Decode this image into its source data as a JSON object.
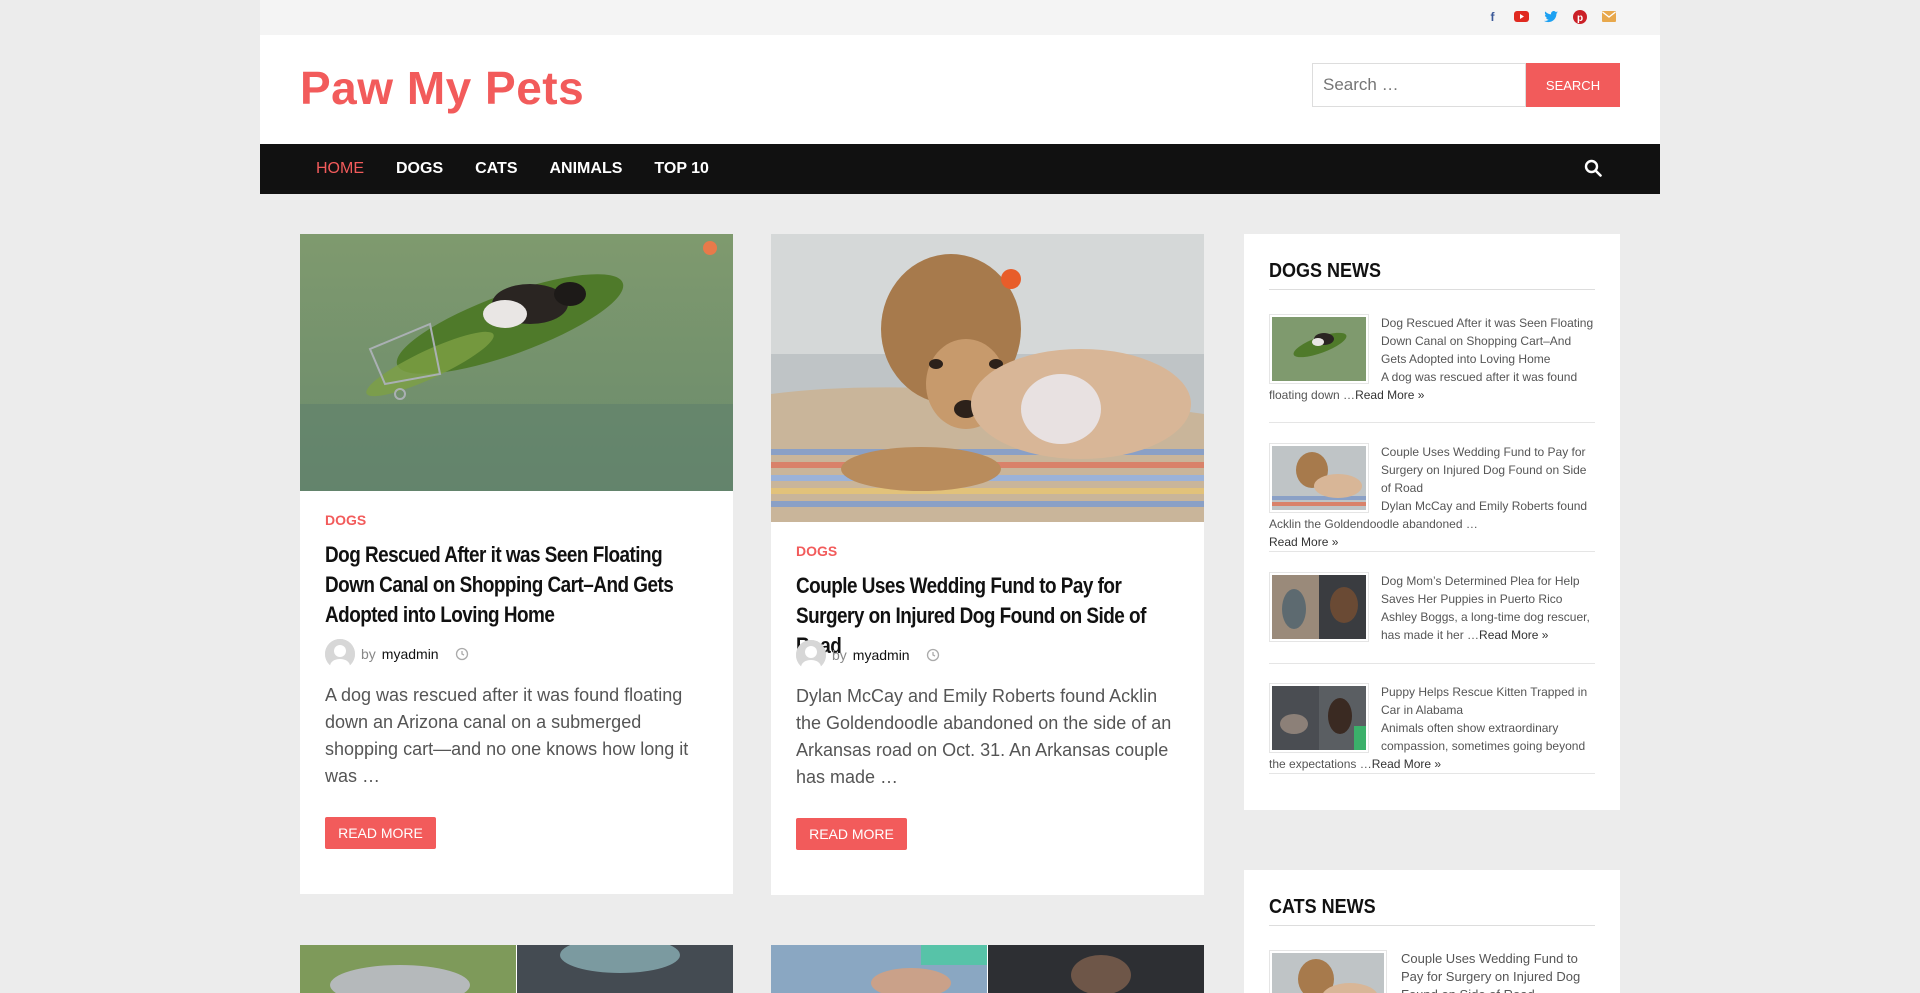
{
  "site": {
    "logo": "Paw My Pets",
    "search_placeholder": "Search …",
    "search_button": "Search"
  },
  "social_icons": [
    "facebook-icon",
    "youtube-icon",
    "twitter-icon",
    "pinterest-icon",
    "email-icon"
  ],
  "nav": {
    "items": [
      "HOME",
      "DOGS",
      "CATS",
      "ANIMALS",
      "TOP 10"
    ],
    "active": "HOME"
  },
  "posts": [
    {
      "category": "DOGS",
      "title": "Dog Rescued After it was Seen Floating Down Canal on Shopping Cart–And Gets Adopted into Loving Home",
      "by": "by",
      "author": "myadmin",
      "excerpt": "A dog was rescued after it was found floating down an Arizona canal on a submerged shopping cart—and no one knows how long it was …",
      "read_more": "Read More"
    },
    {
      "category": "DOGS",
      "title": "Couple Uses Wedding Fund to Pay for Surgery on Injured Dog Found on Side of Road",
      "by": "by",
      "author": "myadmin",
      "excerpt": "Dylan McCay and Emily Roberts found Acklin the Goldendoodle abandoned on the side of an Arkansas road on Oct. 31. An Arkansas couple has made …",
      "read_more": "Read More"
    }
  ],
  "dogs_news": {
    "title": "DOGS NEWS",
    "items": [
      {
        "title": "Dog Rescued After it was Seen Floating Down Canal on Shopping Cart–And Gets Adopted into Loving Home",
        "excerpt": "A dog was rescued after it was found floating down …",
        "read_more": "Read More »"
      },
      {
        "title": "Couple Uses Wedding Fund to Pay for Surgery on Injured Dog Found on Side of Road",
        "excerpt": "Dylan McCay and Emily Roberts found Acklin the Goldendoodle abandoned …",
        "read_more": "Read More »"
      },
      {
        "title": "Dog Mom’s Determined Plea for Help Saves Her Puppies in Puerto Rico",
        "excerpt": "Ashley Boggs, a long-time dog rescuer, has made it her …",
        "read_more": "Read More »"
      },
      {
        "title": "Puppy Helps Rescue Kitten Trapped in Car in Alabama",
        "excerpt": "Animals often show extraordinary compassion, sometimes going beyond the expectations …",
        "read_more": "Read More »"
      }
    ]
  },
  "cats_news": {
    "title": "CATS NEWS",
    "items": [
      {
        "title": "Couple Uses Wedding Fund to Pay for Surgery on Injured Dog Found on Side of Road"
      }
    ]
  },
  "colors": {
    "accent": "#f25b5b",
    "nav_bg": "#111111",
    "page_bg": "#ececec"
  }
}
